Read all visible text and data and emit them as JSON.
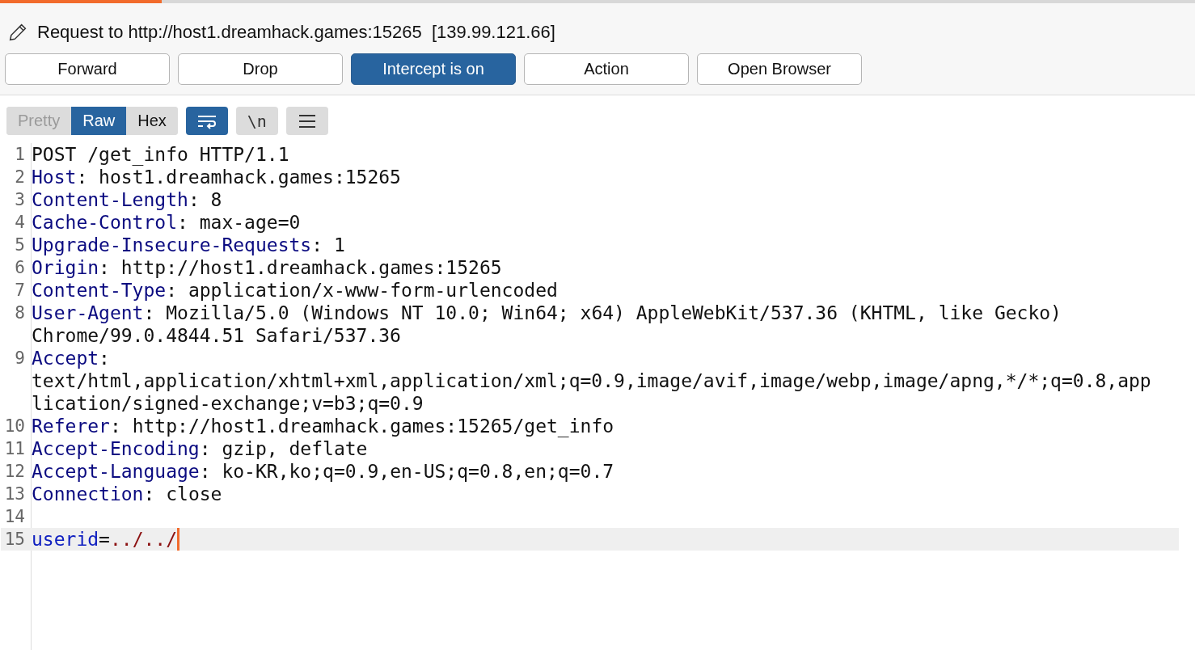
{
  "title": "Request to http://host1.dreamhack.games:15265  [139.99.121.66]",
  "buttons": [
    {
      "label": "Forward",
      "selected": false
    },
    {
      "label": "Drop",
      "selected": false
    },
    {
      "label": "Intercept is on",
      "selected": true
    },
    {
      "label": "Action",
      "selected": false
    },
    {
      "label": "Open Browser",
      "selected": false
    }
  ],
  "view_tabs": [
    {
      "label": "Pretty",
      "selected": false,
      "disabled": true
    },
    {
      "label": "Raw",
      "selected": true,
      "disabled": false
    },
    {
      "label": "Hex",
      "selected": false,
      "disabled": false
    }
  ],
  "wrap_toggle": {
    "on": true
  },
  "newline_toggle": {
    "label": "\\n",
    "on": false
  },
  "lines": [
    {
      "number": "1",
      "kind": "plain",
      "text": "POST /get_info HTTP/1.1",
      "current": false
    },
    {
      "number": "2",
      "kind": "header",
      "name": "Host",
      "separator": ":",
      "value": "host1.dreamhack.games:15265",
      "current": false
    },
    {
      "number": "3",
      "kind": "header",
      "name": "Content-Length",
      "separator": ":",
      "value": "8",
      "current": false
    },
    {
      "number": "4",
      "kind": "header",
      "name": "Cache-Control",
      "separator": ":",
      "value": "max-age=0",
      "current": false
    },
    {
      "number": "5",
      "kind": "header",
      "name": "Upgrade-Insecure-Requests",
      "separator": ":",
      "value": "1",
      "current": false
    },
    {
      "number": "6",
      "kind": "header",
      "name": "Origin",
      "separator": ":",
      "value": "http://host1.dreamhack.games:15265",
      "current": false
    },
    {
      "number": "7",
      "kind": "header",
      "name": "Content-Type",
      "separator": ":",
      "value": "application/x-www-form-urlencoded",
      "current": false
    },
    {
      "number": "8",
      "kind": "header",
      "name": "User-Agent",
      "separator": ":",
      "value": "Mozilla/5.0 (Windows NT 10.0; Win64; x64) AppleWebKit/537.36 (KHTML, like Gecko)",
      "continuation": [
        "Chrome/99.0.4844.51 Safari/537.36"
      ],
      "current": false
    },
    {
      "number": "9",
      "kind": "header",
      "name": "Accept",
      "separator": ":",
      "continuation": [
        "text/html,application/xhtml+xml,application/xml;q=0.9,image/avif,image/webp,image/apng,*/*;q=0.8,app",
        "lication/signed-exchange;v=b3;q=0.9"
      ],
      "current": false
    },
    {
      "number": "10",
      "kind": "header",
      "name": "Referer",
      "separator": ":",
      "value": "http://host1.dreamhack.games:15265/get_info",
      "current": false
    },
    {
      "number": "11",
      "kind": "header",
      "name": "Accept-Encoding",
      "separator": ":",
      "value": "gzip, deflate",
      "current": false
    },
    {
      "number": "12",
      "kind": "header",
      "name": "Accept-Language",
      "separator": ":",
      "value": "ko-KR,ko;q=0.9,en-US;q=0.8,en;q=0.7",
      "current": false
    },
    {
      "number": "13",
      "kind": "header",
      "name": "Connection",
      "separator": ":",
      "value": "close",
      "current": false
    },
    {
      "number": "14",
      "kind": "blank",
      "current": false
    },
    {
      "number": "15",
      "kind": "param",
      "name": "userid",
      "separator": "=",
      "value": "../../",
      "current": true
    }
  ]
}
